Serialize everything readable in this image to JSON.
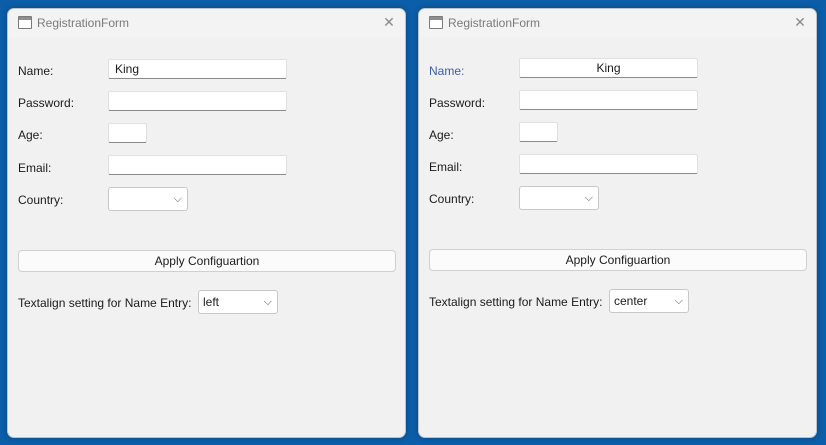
{
  "windows": [
    {
      "title": "RegistrationForm",
      "labels": {
        "name": "Name:",
        "password": "Password:",
        "age": "Age:",
        "email": "Email:",
        "country": "Country:"
      },
      "fields": {
        "name": "King",
        "password": "",
        "age": "",
        "email": "",
        "country": ""
      },
      "name_align": "left",
      "apply_button": "Apply Configuartion",
      "textalign_label": "Textalign setting for Name Entry:",
      "textalign_value": "left"
    },
    {
      "title": "RegistrationForm",
      "labels": {
        "name": "Name:",
        "password": "Password:",
        "age": "Age:",
        "email": "Email:",
        "country": "Country:"
      },
      "fields": {
        "name": "King",
        "password": "",
        "age": "",
        "email": "",
        "country": ""
      },
      "name_align": "center",
      "apply_button": "Apply Configuartion",
      "textalign_label": "Textalign setting for Name Entry:",
      "textalign_value": "center"
    }
  ],
  "icons": {
    "window_icon": "app-window-icon",
    "close_icon": "close-icon",
    "dropdown_icon": "chevron-down-icon"
  },
  "colors": {
    "desktop": "#0c5ea8",
    "focused_label": "#3b5ea8"
  }
}
